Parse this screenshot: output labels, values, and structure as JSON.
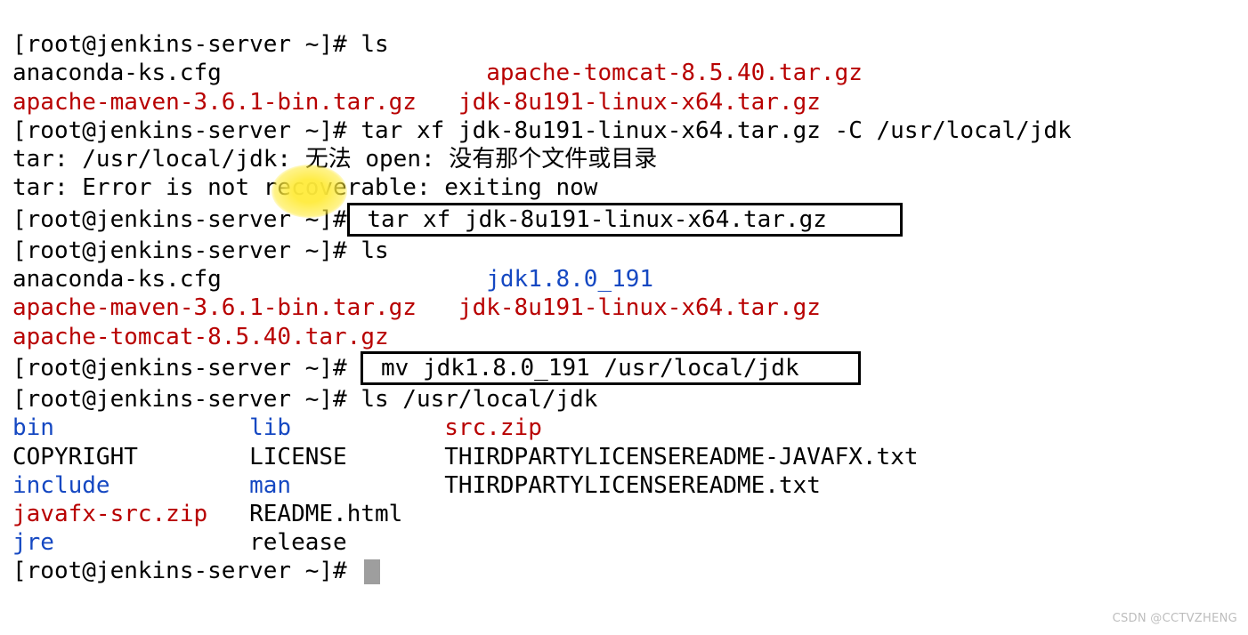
{
  "prompt": "[root@jenkins-server ~]# ",
  "lines": {
    "l1_cmd": "ls",
    "l2a": "anaconda-ks.cfg",
    "l2b": "apache-tomcat-8.5.40.tar.gz",
    "l3a": "apache-maven-3.6.1-bin.tar.gz",
    "l3b": "jdk-8u191-linux-x64.tar.gz",
    "l4_cmd": "tar xf jdk-8u191-linux-x64.tar.gz -C /usr/local/jdk",
    "l5": "tar: /usr/local/jdk: 无法 open: 没有那个文件或目录",
    "l6": "tar: Error is not recoverable: exiting now",
    "l7_prompt_a": "[root@jenkins-se",
    "l7_prompt_b": "rver",
    "l7_prompt_c": " ~]#",
    "l7_cmd": " tar xf jdk-8u191-linux-x64.tar.gz     ",
    "l8_prompt_a": "[root@jenkins-se",
    "l8_prompt_b": "rver",
    "l8_prompt_c": " ~]# ",
    "l8_cmd": "ls",
    "l9a": "anaconda-ks.cfg",
    "l9b": "jdk1.8.0_191",
    "l10a": "apache-maven-3.6.1-bin.tar.gz",
    "l10b": "jdk-8u191-linux-x64.tar.gz",
    "l11": "apache-tomcat-8.5.40.tar.gz",
    "l12_cmd": " mv jdk1.8.0_191 /usr/local/jdk    ",
    "l13_cmd": "ls /usr/local/jdk",
    "f_bin": "bin",
    "f_lib": "lib",
    "f_srczip": "src.zip",
    "f_copy": "COPYRIGHT",
    "f_license": "LICENSE",
    "f_third_fx": "THIRDPARTYLICENSEREADME-JAVAFX.txt",
    "f_include": "include",
    "f_man": "man",
    "f_third": "THIRDPARTYLICENSEREADME.txt",
    "f_javafx": "javafx-src.zip",
    "f_readme": "README.html",
    "f_jre": "jre",
    "f_release": "release"
  },
  "watermark": "CSDN @CCTVZHENG"
}
